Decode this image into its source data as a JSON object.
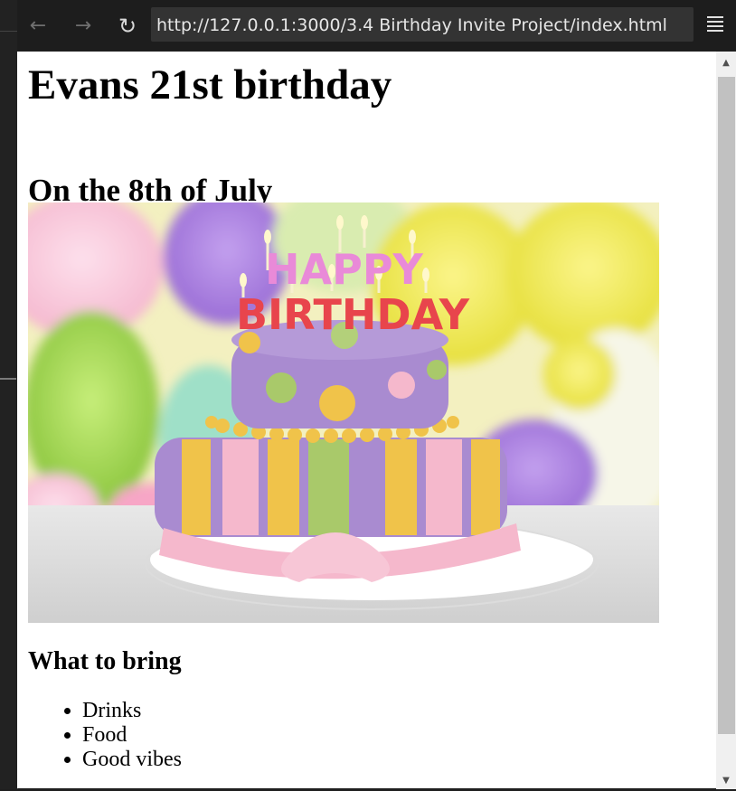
{
  "browser": {
    "url": "http://127.0.0.1:3000/3.4 Birthday Invite Project/index.html",
    "back_icon": "←",
    "forward_icon": "→",
    "reload_icon": "↻",
    "scroll_up_icon": "▲",
    "scroll_down_icon": "▼"
  },
  "page": {
    "title": "Evans 21st birthday",
    "date": "On the 8th of July",
    "image_text": {
      "line1": "HAPPY",
      "line2": "BIRTHDAY"
    },
    "bring_heading": "What to bring",
    "bring_items": [
      "Drinks",
      "Food",
      "Good vibes"
    ]
  },
  "colors": {
    "cake_purple": "#a98bd0",
    "ribbon_pink": "#f5b8cc",
    "stripe_yellow": "#f0c34a",
    "stripe_green": "#a9c96a"
  }
}
